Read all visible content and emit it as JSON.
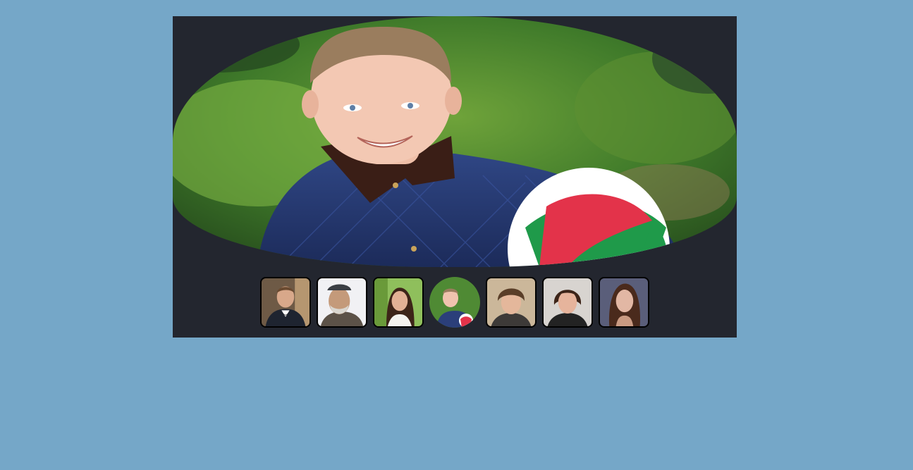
{
  "gallery": {
    "main_image": {
      "icon": "portrait-boy-with-ball-image"
    },
    "thumbnails": [
      {
        "icon": "portrait-man-tuxedo-image",
        "active": false
      },
      {
        "icon": "portrait-bearded-man-cap-image",
        "active": false
      },
      {
        "icon": "portrait-girl-dark-hair-image",
        "active": false
      },
      {
        "icon": "portrait-boy-with-ball-image",
        "active": true
      },
      {
        "icon": "portrait-young-man-shaggy-hair-image",
        "active": false
      },
      {
        "icon": "portrait-woman-short-hair-image",
        "active": false
      },
      {
        "icon": "portrait-young-woman-image",
        "active": false
      }
    ]
  },
  "colors": {
    "page_background": "#75a7c8",
    "gallery_background": "#23262f"
  }
}
